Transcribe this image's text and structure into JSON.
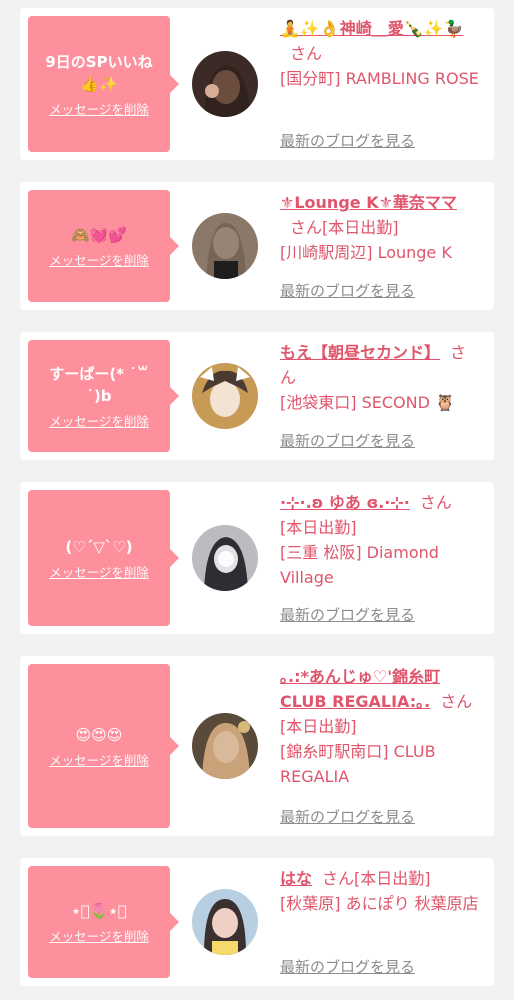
{
  "delete_label": "メッセージを削除",
  "blog_label": "最新のブログを見る",
  "san_label": "さん",
  "cards": [
    {
      "message": "9日のSPいいね\n👍✨",
      "name": "🧘✨👌神崎＿愛🍾✨🦆",
      "status": "",
      "location": "[国分町] RAMBLING ROSE",
      "avatar_colors": [
        "#3b2a25",
        "#b98a6e"
      ]
    },
    {
      "message": "🙈💓💕",
      "name": "⚜Lounge K⚜華奈ママ",
      "status": "[本日出勤]",
      "location": "[川崎駅周辺] Lounge K",
      "avatar_colors": [
        "#6b5a4d",
        "#d8c3b0"
      ]
    },
    {
      "message": "すーぱー(* ˙꒳˙)b",
      "name": "もえ【朝昼セカンド】",
      "status": "",
      "location": "[池袋東口] SECOND 🦉",
      "avatar_colors": [
        "#c79a55",
        "#f3e3d3"
      ]
    },
    {
      "message": "(♡´▽`♡)",
      "name": "⋅⊹⋅.ʚ ゆあ ɞ.⋅⊹⋅",
      "status": "[本日出勤]",
      "location": "[三重 松阪] Diamond Village",
      "avatar_colors": [
        "#2d2d33",
        "#e4e1e6"
      ]
    },
    {
      "message": "😍😍😍",
      "name": "｡.:*あんじゅ♡'錦糸町CLUB REGALIA:｡.",
      "status": "[本日出勤]",
      "location": "[錦糸町駅南口] CLUB REGALIA",
      "avatar_colors": [
        "#5a4a3a",
        "#d9b99b"
      ]
    },
    {
      "message": "⋆͛🌷⋆͛",
      "name": "はな",
      "status": "[本日出勤]",
      "location": "[秋葉原] あにぽり 秋葉原店",
      "avatar_colors": [
        "#3a3030",
        "#f0cfc4"
      ]
    }
  ]
}
